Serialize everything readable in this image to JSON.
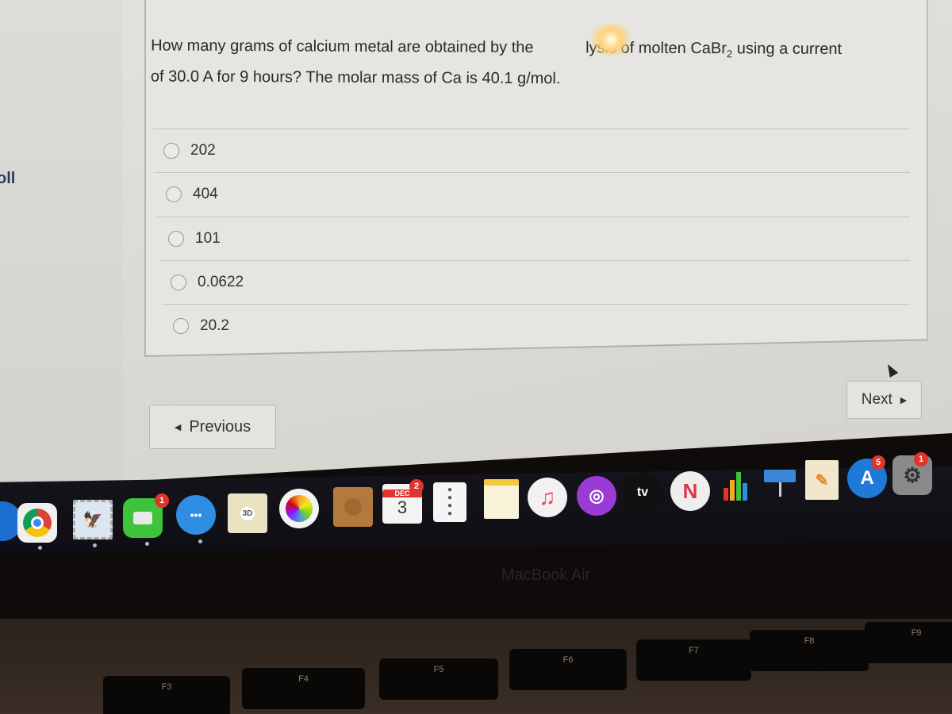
{
  "page": {
    "left_partial_label": "oll"
  },
  "question": {
    "line1_a": "How many grams of calcium metal are obtained by the",
    "line1_b": "lysis of molten CaBr",
    "subscript": "2",
    "line1_c": " using a current",
    "line2": "of 30.0 A for 9 hours? The molar mass of Ca is 40.1 g/mol.",
    "choices": [
      {
        "label": "202",
        "selected": false
      },
      {
        "label": "404",
        "selected": false
      },
      {
        "label": "101",
        "selected": false
      },
      {
        "label": "0.0622",
        "selected": false
      },
      {
        "label": "20.2",
        "selected": false
      }
    ]
  },
  "navigation": {
    "previous_label": "Previous",
    "previous_icon": "triangle-left",
    "next_label": "Next",
    "next_icon": "triangle-right"
  },
  "dock": {
    "items": [
      {
        "name": "Safari",
        "icon": "safari-icon"
      },
      {
        "name": "Google Chrome",
        "icon": "chrome-icon",
        "running": true
      },
      {
        "name": "Mail",
        "icon": "mail-icon",
        "running": true
      },
      {
        "name": "FaceTime",
        "icon": "facetime-icon",
        "badge": "1",
        "running": true
      },
      {
        "name": "Messages",
        "icon": "messages-icon",
        "running": true
      },
      {
        "name": "Maps",
        "icon": "maps-icon",
        "label": "3D"
      },
      {
        "name": "Photos",
        "icon": "photos-icon"
      },
      {
        "name": "Contacts",
        "icon": "contacts-icon"
      },
      {
        "name": "Calendar",
        "icon": "calendar-icon",
        "month": "DEC",
        "day": "3",
        "badge": "2"
      },
      {
        "name": "Reminders",
        "icon": "reminders-icon"
      },
      {
        "name": "Notes",
        "icon": "notes-icon"
      },
      {
        "name": "Music",
        "icon": "music-icon"
      },
      {
        "name": "Podcasts",
        "icon": "podcasts-icon"
      },
      {
        "name": "TV",
        "icon": "tv-icon",
        "label": "tv"
      },
      {
        "name": "News",
        "icon": "news-icon"
      },
      {
        "name": "Numbers",
        "icon": "numbers-icon"
      },
      {
        "name": "Keynote",
        "icon": "keynote-icon"
      },
      {
        "name": "Pages",
        "icon": "pages-icon"
      },
      {
        "name": "App Store",
        "icon": "app-store-icon",
        "badge": "5"
      },
      {
        "name": "System Preferences",
        "icon": "system-preferences-icon",
        "badge": "1"
      }
    ]
  },
  "hardware": {
    "bezel_label": "MacBook Air",
    "keys": [
      "F3",
      "F4",
      "F5",
      "F6",
      "F7",
      "F8",
      "F9"
    ]
  }
}
